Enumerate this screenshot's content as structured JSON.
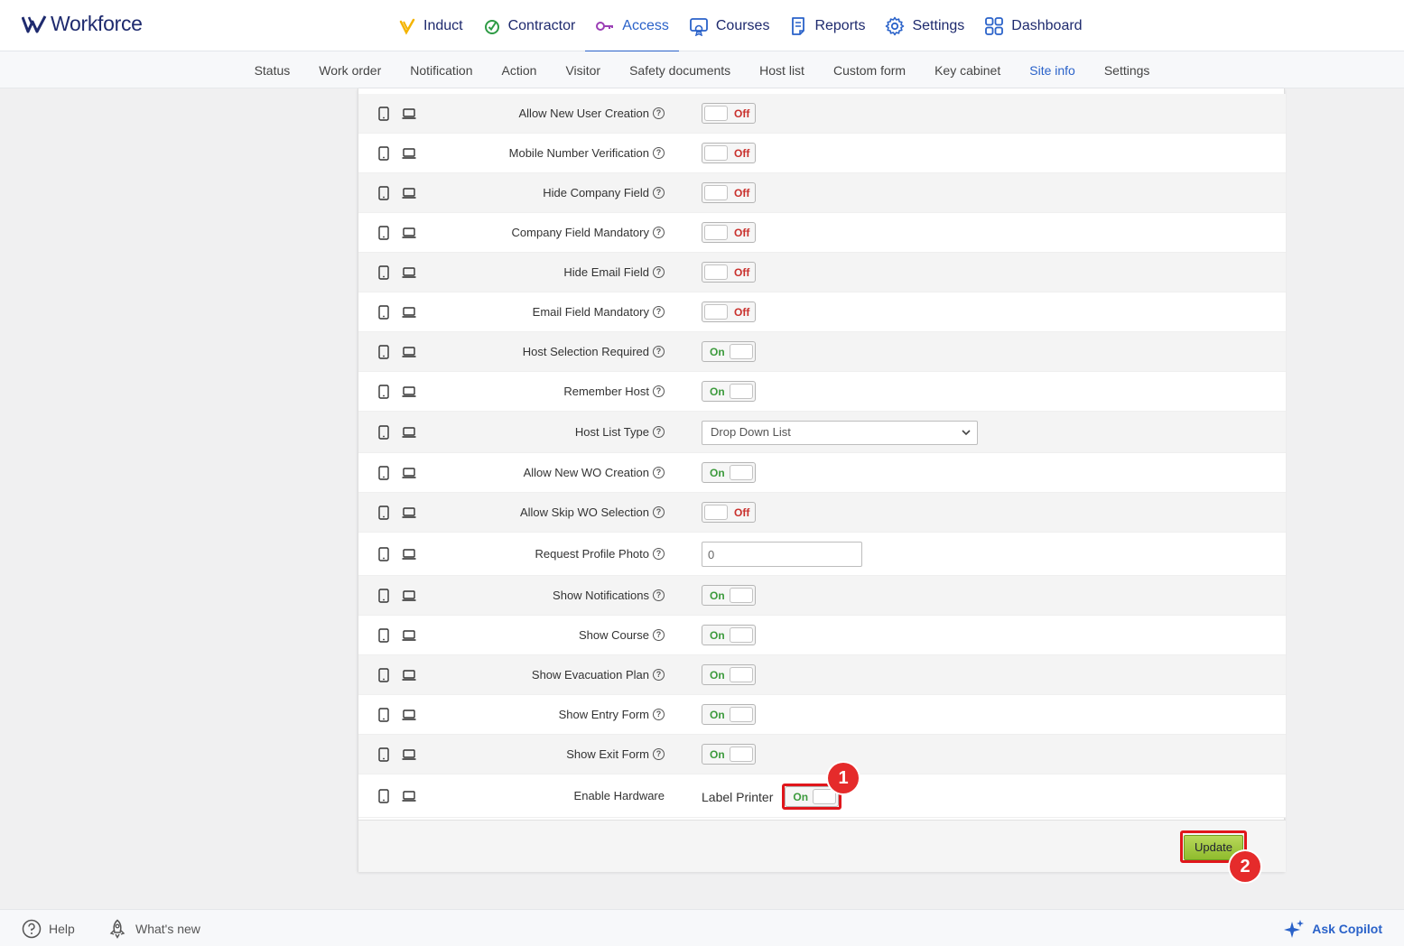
{
  "brand": {
    "name": "Workforce"
  },
  "nav": {
    "items": [
      {
        "label": "Induct",
        "icon": "induct-icon"
      },
      {
        "label": "Contractor",
        "icon": "contractor-icon"
      },
      {
        "label": "Access",
        "icon": "key-icon",
        "active": true
      },
      {
        "label": "Courses",
        "icon": "courses-icon"
      },
      {
        "label": "Reports",
        "icon": "reports-icon"
      },
      {
        "label": "Settings",
        "icon": "gear-icon"
      },
      {
        "label": "Dashboard",
        "icon": "dashboard-icon"
      }
    ]
  },
  "subnav": {
    "items": [
      "Status",
      "Work order",
      "Notification",
      "Action",
      "Visitor",
      "Safety documents",
      "Host list",
      "Custom form",
      "Key cabinet",
      "Site info",
      "Settings"
    ],
    "active": "Site info"
  },
  "settings": {
    "rows": [
      {
        "label": "Allow New User Creation",
        "type": "toggle",
        "value": "Off"
      },
      {
        "label": "Mobile Number Verification",
        "type": "toggle",
        "value": "Off"
      },
      {
        "label": "Hide Company Field",
        "type": "toggle",
        "value": "Off"
      },
      {
        "label": "Company Field Mandatory",
        "type": "toggle",
        "value": "Off"
      },
      {
        "label": "Hide Email Field",
        "type": "toggle",
        "value": "Off"
      },
      {
        "label": "Email Field Mandatory",
        "type": "toggle",
        "value": "Off"
      },
      {
        "label": "Host Selection Required",
        "type": "toggle",
        "value": "On"
      },
      {
        "label": "Remember Host",
        "type": "toggle",
        "value": "On"
      },
      {
        "label": "Host List Type",
        "type": "select",
        "value": "Drop Down List"
      },
      {
        "label": "Allow New WO Creation",
        "type": "toggle",
        "value": "On"
      },
      {
        "label": "Allow Skip WO Selection",
        "type": "toggle",
        "value": "Off"
      },
      {
        "label": "Request Profile Photo",
        "type": "text",
        "value": "0"
      },
      {
        "label": "Show Notifications",
        "type": "toggle",
        "value": "On"
      },
      {
        "label": "Show Course",
        "type": "toggle",
        "value": "On"
      },
      {
        "label": "Show Evacuation Plan",
        "type": "toggle",
        "value": "On"
      },
      {
        "label": "Show Entry Form",
        "type": "toggle",
        "value": "On"
      },
      {
        "label": "Show Exit Form",
        "type": "toggle",
        "value": "On"
      },
      {
        "label": "Enable Hardware",
        "type": "hardware",
        "sublabel": "Label Printer",
        "value": "On"
      }
    ],
    "help_glyph": "?"
  },
  "annotations": {
    "step1": "1",
    "step2": "2"
  },
  "actions": {
    "update_label": "Update"
  },
  "bottom": {
    "help": "Help",
    "whats_new": "What's new",
    "copilot": "Ask Copilot"
  },
  "colors": {
    "accent": "#2a62c9",
    "brand": "#1e2a6e",
    "on": "#3c9a3c",
    "off": "#c9302c",
    "highlight": "#e0161b",
    "update": "#9cc53a"
  }
}
